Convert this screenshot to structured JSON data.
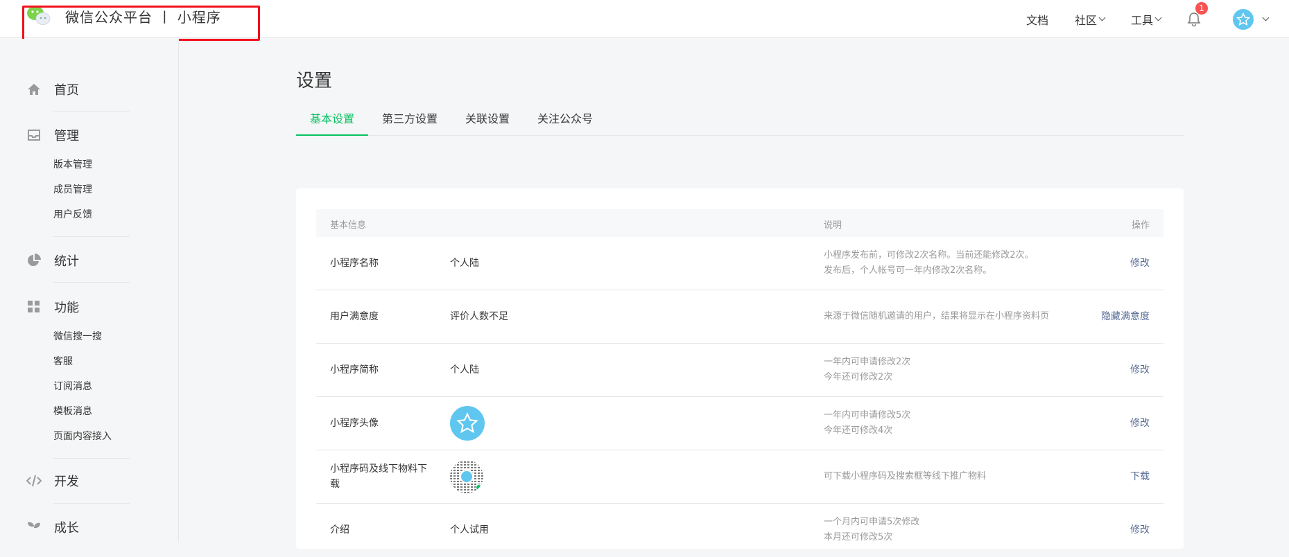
{
  "header": {
    "brand": "微信公众平台 丨 小程序",
    "nav": {
      "docs": "文档",
      "community": "社区",
      "tools": "工具",
      "notification_count": "1"
    }
  },
  "sidebar": {
    "home": "首页",
    "manage": {
      "label": "管理",
      "items": [
        "版本管理",
        "成员管理",
        "用户反馈"
      ]
    },
    "stats": "统计",
    "features": {
      "label": "功能",
      "items": [
        "微信搜一搜",
        "客服",
        "订阅消息",
        "模板消息",
        "页面内容接入"
      ]
    },
    "dev": "开发",
    "growth": "成长"
  },
  "main": {
    "title": "设置",
    "tabs": [
      "基本设置",
      "第三方设置",
      "关联设置",
      "关注公众号"
    ],
    "active_tab": "基本设置",
    "table": {
      "headers": {
        "info": "基本信息",
        "desc": "说明",
        "action": "操作"
      },
      "rows": [
        {
          "name": "小程序名称",
          "value": "个人陆",
          "desc1": "小程序发布前，可修改2次名称。当前还能修改2次。",
          "desc2": "发布后，个人帐号可一年内修改2次名称。",
          "action": "修改"
        },
        {
          "name": "用户满意度",
          "value": "评价人数不足",
          "desc1": "来源于微信随机邀请的用户，结果将显示在小程序资料页",
          "desc2": "",
          "action": "隐藏满意度"
        },
        {
          "name": "小程序简称",
          "value": "个人陆",
          "desc1": "一年内可申请修改2次",
          "desc2": "今年还可修改2次",
          "action": "修改"
        },
        {
          "name": "小程序头像",
          "value": "",
          "desc1": "一年内可申请修改5次",
          "desc2": "今年还可修改4次",
          "action": "修改"
        },
        {
          "name": "小程序码及线下物料下载",
          "value": "",
          "desc1": "可下载小程序码及搜索框等线下推广物料",
          "desc2": "",
          "action": "下载"
        },
        {
          "name": "介绍",
          "value": "个人试用",
          "desc1": "一个月内可申请5次修改",
          "desc2": "本月还可修改5次",
          "action": "修改"
        }
      ]
    }
  },
  "colors": {
    "accent": "#07c160",
    "link": "#576b95",
    "badge": "#fa5151",
    "highlight": "#f0101c"
  }
}
